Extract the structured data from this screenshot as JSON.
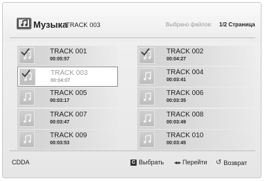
{
  "header": {
    "title": "Музыка",
    "subtitle": "TRACK 003",
    "selected_label": "Выбрано файлов:",
    "page": "1/2 Страница"
  },
  "tracks": [
    {
      "name": "TRACK 001",
      "time": "00:05:57",
      "checked": true,
      "selected": false
    },
    {
      "name": "TRACK 002",
      "time": "00:04:27",
      "checked": true,
      "selected": false
    },
    {
      "name": "TRACK 003",
      "time": "00:04:07",
      "checked": true,
      "selected": true
    },
    {
      "name": "TRACK 004",
      "time": "00:03:41",
      "checked": false,
      "selected": false
    },
    {
      "name": "TRACK 005",
      "time": "00:03:17",
      "checked": false,
      "selected": false
    },
    {
      "name": "TRACK 006",
      "time": "00:03:35",
      "checked": false,
      "selected": false
    },
    {
      "name": "TRACK 007",
      "time": "00:03:47",
      "checked": false,
      "selected": false
    },
    {
      "name": "TRACK 008",
      "time": "00:03:49",
      "checked": false,
      "selected": false
    },
    {
      "name": "TRACK 009",
      "time": "00:03:53",
      "checked": false,
      "selected": false
    },
    {
      "name": "TRACK 010",
      "time": "00:03:45",
      "checked": false,
      "selected": false
    }
  ],
  "footer": {
    "source": "CDDA",
    "select_key": "C",
    "select_label": "Выбрать",
    "navigate_label": "Перейти",
    "return_label": "Возврат"
  },
  "icons": {
    "header": "music-folder-icon",
    "track": "music-note-icon",
    "checked": "checkmark-icon",
    "navigate": "left-right-arrows-icon",
    "return": "return-icon"
  }
}
